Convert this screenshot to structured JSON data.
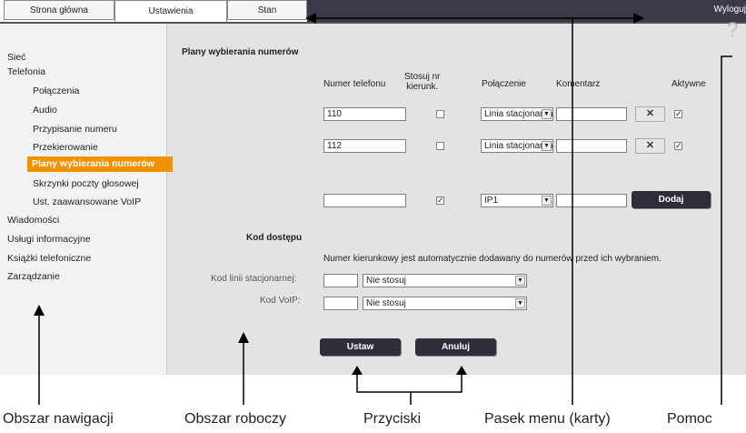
{
  "tabs": [
    {
      "label": "Strona główna"
    },
    {
      "label": "Ustawienia"
    },
    {
      "label": "Stan"
    }
  ],
  "logout_label": "Wyloguj",
  "help_icon": "?",
  "nav": {
    "items": [
      {
        "label": "Sieć"
      },
      {
        "label": "Telefonia"
      },
      {
        "label": "Połączenia"
      },
      {
        "label": "Audio"
      },
      {
        "label": "Przypisanie numeru"
      },
      {
        "label": "Przekierowanie"
      },
      {
        "label": "Plany wybierania numerów",
        "active": true
      },
      {
        "label": "Skrzynki poczty głosowej"
      },
      {
        "label": "Ust. zaawansowane VoIP"
      },
      {
        "label": "Wiadomości"
      },
      {
        "label": "Usługi informacyjne"
      },
      {
        "label": "Książki telefoniczne"
      },
      {
        "label": "Zarządzanie"
      }
    ]
  },
  "section_title": "Plany wybierania numerów",
  "table": {
    "headers": {
      "phone": "Numer telefonu",
      "prefix_line1": "Stosuj nr",
      "prefix_line2": "kierunk.",
      "connection": "Połączenie",
      "comment": "Komentarz",
      "active": "Aktywne"
    },
    "rows": [
      {
        "phone": "110",
        "prefix": false,
        "connection": "Linia stacjonarna",
        "comment": "",
        "delete": "✕",
        "active": true
      },
      {
        "phone": "112",
        "prefix": false,
        "connection": "Linia stacjonarna",
        "comment": "",
        "delete": "✕",
        "active": true
      }
    ],
    "new_row": {
      "phone": "",
      "prefix": true,
      "connection": "IP1",
      "comment": "",
      "add_label": "Dodaj"
    }
  },
  "access_code": {
    "title": "Kod dostępu",
    "note": "Numer kierunkowy jest automatycznie dodawany do numerów przed ich wybraniem.",
    "landline_label": "Kod linii stacjonarnej:",
    "landline_value": "",
    "landline_option": "Nie stosuj",
    "voip_label": "Kod VoIP:",
    "voip_value": "",
    "voip_option": "Nie stosuj"
  },
  "buttons": {
    "set": "Ustaw",
    "cancel": "Anuluj"
  },
  "captions": {
    "nav_area": "Obszar nawigacji",
    "work_area": "Obszar roboczy",
    "buttons": "Przyciski",
    "menu_bar": "Pasek menu (karty)",
    "help": "Pomoc"
  },
  "colors": {
    "accent_orange": "#f39200",
    "dark_bar": "#3a3a48",
    "button_dark": "#2e2e3a",
    "nav_bg": "#f2f2f2",
    "work_bg": "#e3e3e3"
  }
}
